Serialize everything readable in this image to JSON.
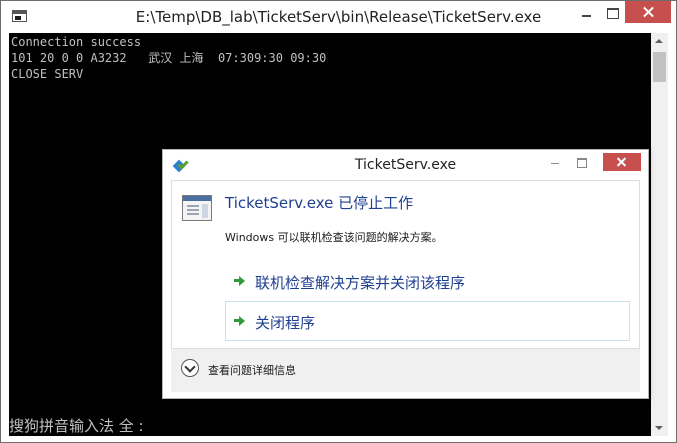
{
  "window": {
    "title": "E:\\Temp\\DB_lab\\TicketServ\\bin\\Release\\TicketServ.exe",
    "icon": "console-window-icon"
  },
  "console": {
    "lines": [
      "Connection success",
      "101 20 0 0 A3232   武汉 上海  07:309:30 09:30",
      "CLOSE SERV"
    ],
    "ime_status": "搜狗拼音输入法 全 :"
  },
  "dialog": {
    "title": "TicketServ.exe",
    "main_instruction": "TicketServ.exe 已停止工作",
    "content": "Windows 可以联机检查该问题的解决方案。",
    "command_links": [
      "联机检查解决方案并关闭该程序",
      "关闭程序"
    ],
    "details_label": "查看问题详细信息"
  },
  "colors": {
    "console_background": "#000000",
    "console_text": "#c0c0c0",
    "close_button": "#c7504f",
    "link_text": "#1f3f8f",
    "command_arrow": "#2f9a3a"
  }
}
